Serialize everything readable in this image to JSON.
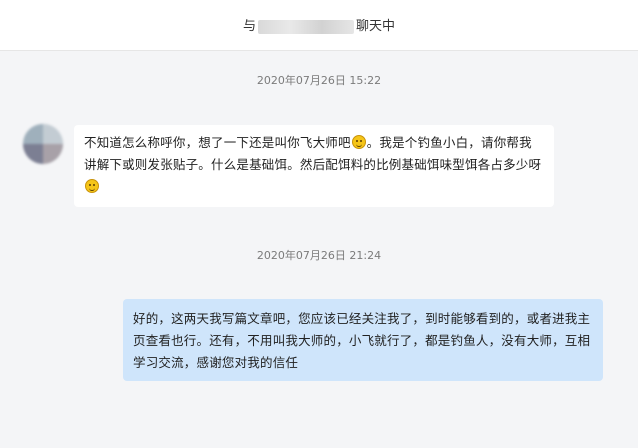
{
  "header": {
    "title_prefix": "与",
    "title_suffix": "聊天中"
  },
  "messages": [
    {
      "timestamp": "2020年07月26日 15:22",
      "direction": "incoming",
      "avatar_icon": "user-avatar-icon",
      "text_part1": "不知道怎么称呼你，想了一下还是叫你飞大师吧",
      "emoji1": "smile-emoji",
      "text_part2": "。我是个钓鱼小白，请你帮我讲解下或则发张贴子。什么是基础饵。然后配饵料的比例基础饵味型饵各占多少呀",
      "emoji2": "grin-emoji"
    },
    {
      "timestamp": "2020年07月26日 21:24",
      "direction": "outgoing",
      "text": "好的，这两天我写篇文章吧，您应该已经关注我了，到时能够看到的，或者进我主页查看也行。还有，不用叫我大师的，小飞就行了，都是钓鱼人，没有大师，互相学习交流，感谢您对我的信任"
    }
  ],
  "colors": {
    "background": "#f4f5f7",
    "incoming_bubble": "#ffffff",
    "outgoing_bubble": "#cfe5fb",
    "timestamp": "#7b7b7b"
  }
}
